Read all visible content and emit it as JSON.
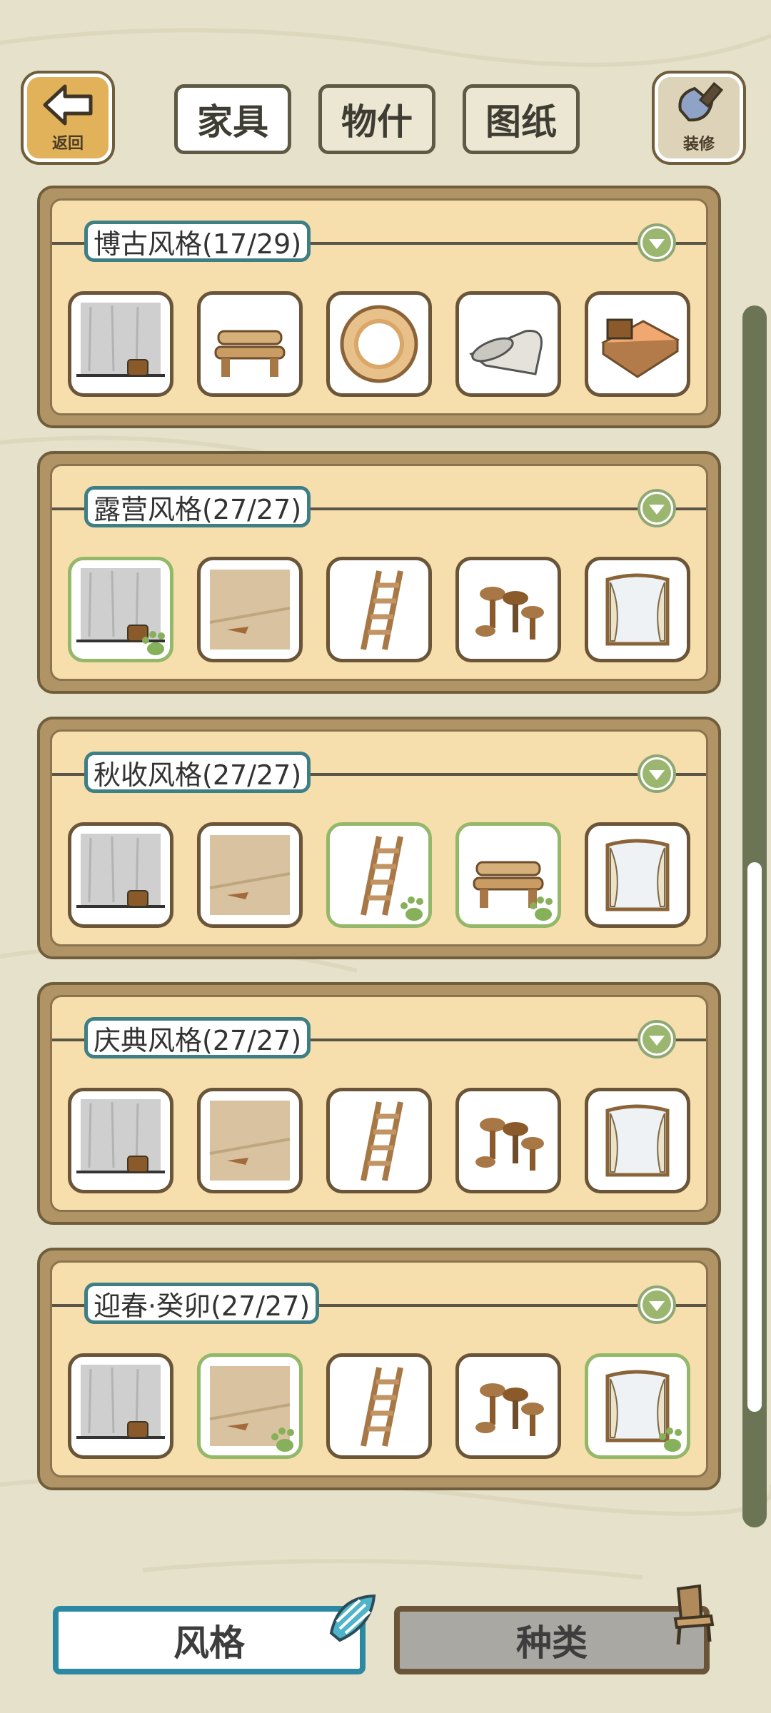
{
  "top": {
    "back_label": "返回",
    "decorate_label": "装修",
    "tabs": [
      "家具",
      "物什",
      "图纸"
    ],
    "active_tab": 0
  },
  "categories": [
    {
      "title": "博古风格(17/29)",
      "owned": [
        false,
        false,
        false,
        false,
        false
      ],
      "items": [
        "wall-item",
        "bench-item",
        "rug-item",
        "scroll-item",
        "bed-item"
      ]
    },
    {
      "title": "露营风格(27/27)",
      "owned": [
        true,
        false,
        false,
        false,
        false
      ],
      "items": [
        "wall-item",
        "floor-item",
        "ladder-item",
        "table-set-item",
        "window-item"
      ]
    },
    {
      "title": "秋收风格(27/27)",
      "owned": [
        false,
        false,
        true,
        true,
        false
      ],
      "items": [
        "wall-item",
        "floor-item",
        "ladder-item",
        "bench-item",
        "window-item"
      ]
    },
    {
      "title": "庆典风格(27/27)",
      "owned": [
        false,
        false,
        false,
        false,
        false
      ],
      "items": [
        "wall-item",
        "floor-item",
        "ladder-item",
        "table-set-item",
        "window-item"
      ]
    },
    {
      "title": "迎春·癸卯(27/27)",
      "owned": [
        false,
        true,
        false,
        false,
        true
      ],
      "items": [
        "wall-item",
        "floor-item",
        "ladder-item",
        "table-set-item",
        "window-item"
      ]
    }
  ],
  "bottom": {
    "style_label": "风格",
    "kind_label": "种类"
  },
  "colors": {
    "background": "#e6e1cb",
    "panel": "#f7dfad",
    "accent_teal": "#2b8aa1",
    "owned_green": "#94b86a"
  }
}
